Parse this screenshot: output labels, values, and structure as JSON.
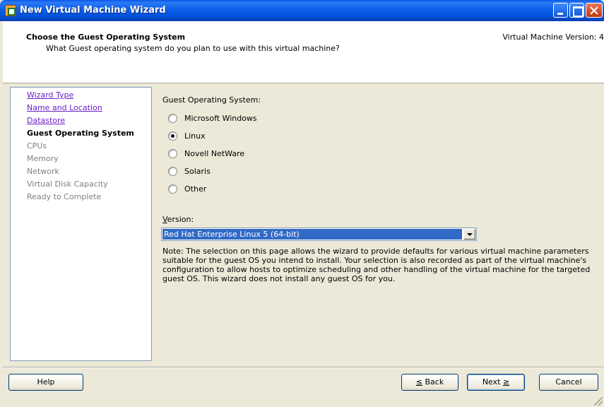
{
  "window": {
    "title": "New Virtual Machine Wizard",
    "icon": "vmware-vm-icon"
  },
  "header": {
    "title": "Choose the Guest Operating System",
    "subtitle": "What Guest operating system do you plan to use with this virtual machine?",
    "version": "Virtual Machine Version: 4"
  },
  "nav": {
    "items": [
      {
        "label": "Wizard Type",
        "state": "link"
      },
      {
        "label": "Name and Location",
        "state": "link"
      },
      {
        "label": "Datastore",
        "state": "link"
      },
      {
        "label": "Guest Operating System",
        "state": "current"
      },
      {
        "label": "CPUs",
        "state": "future"
      },
      {
        "label": "Memory",
        "state": "future"
      },
      {
        "label": "Network",
        "state": "future"
      },
      {
        "label": "Virtual Disk Capacity",
        "state": "future"
      },
      {
        "label": "Ready to Complete",
        "state": "future"
      }
    ]
  },
  "main": {
    "os_label": "Guest Operating System:",
    "os_options": [
      {
        "label": "Microsoft Windows",
        "checked": false
      },
      {
        "label": "Linux",
        "checked": true
      },
      {
        "label": "Novell NetWare",
        "checked": false
      },
      {
        "label": "Solaris",
        "checked": false
      },
      {
        "label": "Other",
        "checked": false
      }
    ],
    "version_label_underlined": "V",
    "version_label_rest": "ersion:",
    "version_value": "Red Hat Enterprise Linux 5 (64-bit)",
    "note": "Note: The selection on this page allows the wizard to provide defaults for various virtual machine parameters suitable for the guest OS you intend to install. Your selection is also recorded as part of the virtual machine's configuration  to allow hosts to optimize scheduling and other handling of the virtual machine for the targeted guest OS. This wizard does not install any guest OS for you."
  },
  "buttons": {
    "help": "Help",
    "back_prefix": "≤",
    "back_label": " Back",
    "next_label": "Next ",
    "next_suffix": "≥",
    "cancel": "Cancel"
  }
}
